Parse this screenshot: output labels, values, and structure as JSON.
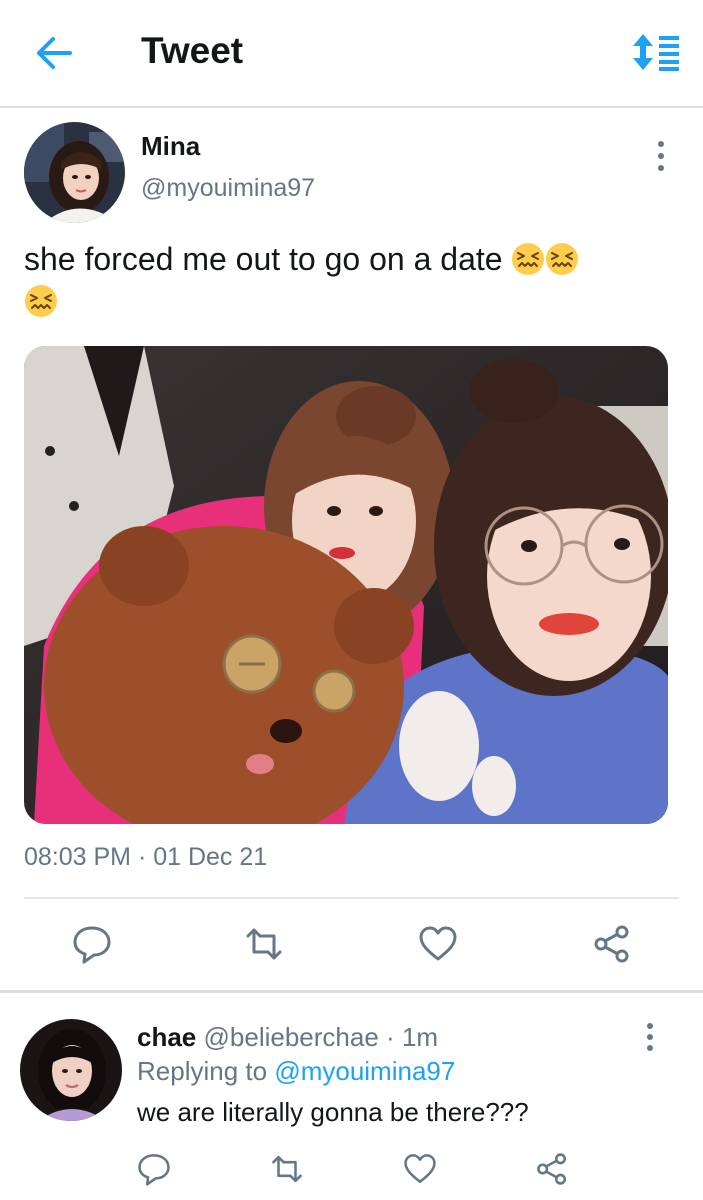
{
  "header": {
    "title": "Tweet",
    "back_icon": "arrow-left-icon",
    "sort_icon": "sort-icon",
    "accent": "#1da1f2"
  },
  "tweet": {
    "author_name": "Mina",
    "author_handle": "@myouimina97",
    "text": "she forced me out to go on a date",
    "emoji": [
      "confounded-face",
      "confounded-face",
      "confounded-face"
    ],
    "timestamp": "08:03 PM · 01 Dec 21",
    "actions": [
      "reply-icon",
      "retweet-icon",
      "like-icon",
      "share-icon"
    ]
  },
  "reply": {
    "author_name": "chae",
    "author_handle": "@belieberchae",
    "separator": "·",
    "time": "1m",
    "replying_prefix": "Replying to",
    "replying_to": "@myouimina97",
    "text": "we are literally gonna be there???"
  },
  "colors": {
    "text": "#14171a",
    "muted": "#657786",
    "link": "#1da1f2",
    "divider": "#e1e6ea"
  }
}
